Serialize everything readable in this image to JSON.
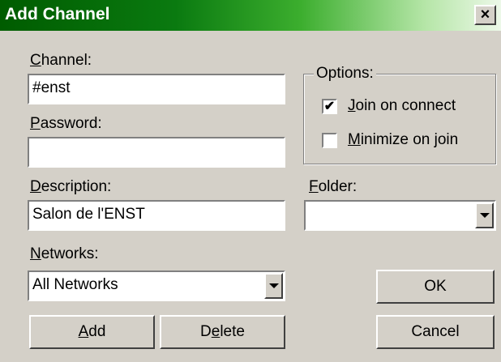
{
  "window": {
    "title": "Add Channel",
    "close_glyph": "×"
  },
  "channel": {
    "label_mnemonic": "C",
    "label_rest": "hannel:",
    "value": "#enst"
  },
  "password": {
    "label_mnemonic": "P",
    "label_rest": "assword:",
    "value": ""
  },
  "description": {
    "label_mnemonic": "D",
    "label_rest": "escription:",
    "value": "Salon de l'ENST"
  },
  "networks": {
    "label_mnemonic": "N",
    "label_rest": "etworks:",
    "selected": "All Networks"
  },
  "options": {
    "legend": "Options:",
    "join_on_connect": {
      "label_mnemonic": "J",
      "label_rest": "oin on connect",
      "checked": true,
      "check_glyph": "✔"
    },
    "minimize_on_join": {
      "label_mnemonic": "M",
      "label_rest": "inimize on join",
      "checked": false,
      "check_glyph": ""
    }
  },
  "folder": {
    "label_mnemonic": "F",
    "label_rest": "older:",
    "selected": ""
  },
  "buttons": {
    "add": {
      "mnemonic": "A",
      "rest": "dd"
    },
    "delete": {
      "pre": "D",
      "mnemonic": "e",
      "rest": "lete"
    },
    "ok": "OK",
    "cancel": "Cancel"
  },
  "colors": {
    "face": "#d4d0c8",
    "title_start": "#005c00",
    "title_end": "#ecf8e8"
  }
}
